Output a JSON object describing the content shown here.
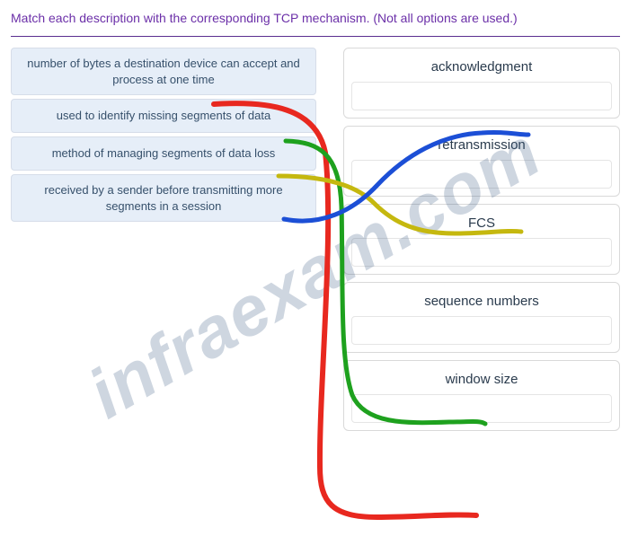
{
  "prompt": "Match each description with the corresponding TCP mechanism. (Not all options are used.)",
  "left": {
    "items": [
      {
        "text": "number of bytes a destination device can accept and process at one time"
      },
      {
        "text": "used to identify missing segments of data"
      },
      {
        "text": "method of managing segments of data loss"
      },
      {
        "text": "received by a sender before transmitting more segments in a session"
      }
    ]
  },
  "right": {
    "items": [
      {
        "label": "acknowledgment"
      },
      {
        "label": "retransmission"
      },
      {
        "label": "FCS"
      },
      {
        "label": "sequence numbers"
      },
      {
        "label": "window size"
      }
    ]
  },
  "matches": [
    {
      "left_index": 0,
      "right_label": "window size",
      "color": "#e8281f"
    },
    {
      "left_index": 1,
      "right_label": "sequence numbers",
      "color": "#1ea11e"
    },
    {
      "left_index": 2,
      "right_label": "retransmission",
      "color": "#c5b80f"
    },
    {
      "left_index": 3,
      "right_label": "acknowledgment",
      "color": "#1c4fd6"
    }
  ],
  "watermark": "infraexam.com"
}
